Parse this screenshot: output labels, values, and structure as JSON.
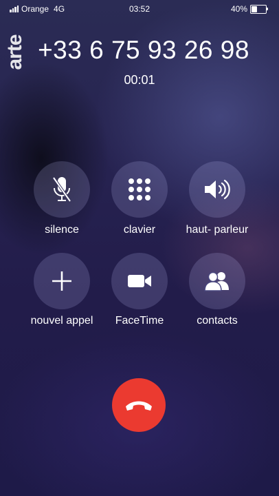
{
  "status_bar": {
    "carrier": "Orange",
    "network": "4G",
    "time": "03:52",
    "battery_percent": "40%",
    "battery_level": 0.4
  },
  "logo_text": "arte",
  "call": {
    "number": "+33 6 75 93 26 98",
    "duration": "00:01"
  },
  "controls": {
    "mute_label": "silence",
    "keypad_label": "clavier",
    "speaker_label": "haut- parleur",
    "add_call_label": "nouvel appel",
    "facetime_label": "FaceTime",
    "contacts_label": "contacts"
  },
  "colors": {
    "end_call": "#eb3a30",
    "button_bg": "rgba(200,200,255,0.18)"
  }
}
